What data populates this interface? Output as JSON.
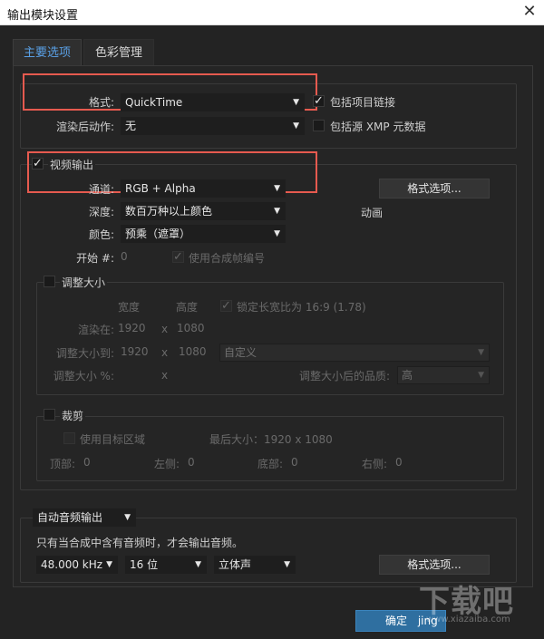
{
  "window": {
    "title": "输出模块设置"
  },
  "tabs": [
    "主要选项",
    "色彩管理"
  ],
  "format": {
    "label": "格式:",
    "value": "QuickTime",
    "include_links_label": "包括项目链接"
  },
  "post_render": {
    "label": "渲染后动作:",
    "value": "无",
    "include_xmp_label": "包括源 XMP 元数据"
  },
  "video": {
    "label": "视频输出",
    "channels_label": "通道:",
    "channels_value": "RGB + Alpha",
    "format_options": "格式选项...",
    "depth_label": "深度:",
    "depth_value": "数百万种以上颜色",
    "animation": "动画",
    "color_label": "颜色:",
    "color_value": "预乘（遮罩）",
    "start_label": "开始 #:",
    "start_value": "0",
    "use_comp_frame": "使用合成帧编号"
  },
  "resize": {
    "label": "调整大小",
    "width_hdr": "宽度",
    "height_hdr": "高度",
    "lock_label": "锁定长宽比为 16:9 (1.78)",
    "render_at": "渲染在:",
    "rw": "1920",
    "x1": "x",
    "rh": "1080",
    "resize_to": "调整大小到:",
    "tw": "1920",
    "x2": "x",
    "th": "1080",
    "custom": "自定义",
    "resize_pct": "调整大小 %:",
    "x3": "x",
    "quality_label": "调整大小后的品质:",
    "quality_value": "高"
  },
  "crop": {
    "label": "裁剪",
    "use_roi": "使用目标区域",
    "final_size": "最后大小：1920 x 1080",
    "top": "顶部:",
    "top_v": "0",
    "left": "左侧:",
    "left_v": "0",
    "bottom": "底部:",
    "bottom_v": "0",
    "right": "右侧:",
    "right_v": "0"
  },
  "audio": {
    "mode": "自动音频输出",
    "note": "只有当合成中含有音频时，才会输出音频。",
    "rate": "48.000 kHz",
    "bits": "16 位",
    "channels": "立体声",
    "format_options": "格式选项..."
  },
  "ok_label": "确定",
  "ok_extra": "jing",
  "watermark": {
    "brand": "下载吧",
    "url": "www.xiazaiba.com"
  },
  "colors": {
    "accent": "#5aa0e6",
    "highlight": "#e65a4f",
    "ok": "#2f6fa0"
  }
}
